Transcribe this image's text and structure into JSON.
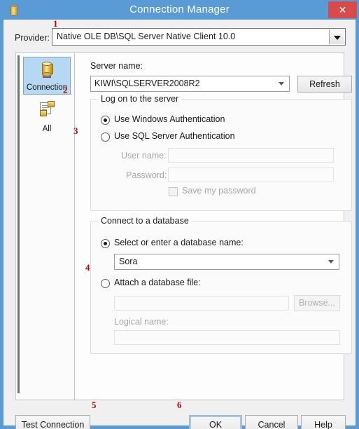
{
  "window": {
    "title": "Connection Manager",
    "icon": "database-icon",
    "close_label": "✕",
    "titlebar_color": "#5b9bd5",
    "close_color": "#d94a4a",
    "marker_color": "#c00000"
  },
  "provider": {
    "label": "Provider:",
    "value": "Native OLE DB\\SQL Server Native Client 10.0",
    "marker": "1"
  },
  "sidebar": {
    "items": [
      {
        "label": "Connection",
        "icon": "database-icon",
        "selected": true
      },
      {
        "label": "All",
        "icon": "properties-icon",
        "selected": false
      }
    ]
  },
  "server": {
    "label": "Server name:",
    "value": "KIWI\\SQLSERVER2008R2",
    "refresh_label": "Refresh",
    "marker": "2"
  },
  "logon": {
    "group_title": "Log on to the server",
    "windows_auth_label": "Use Windows Authentication",
    "windows_auth_selected": true,
    "sql_auth_label": "Use SQL Server Authentication",
    "sql_auth_selected": false,
    "username_label": "User name:",
    "username_value": "",
    "password_label": "Password:",
    "password_value": "",
    "save_password_label": "Save my password",
    "save_password_checked": false,
    "marker": "3"
  },
  "database": {
    "group_title": "Connect to a database",
    "select_db_label": "Select or enter a database name:",
    "select_db_selected": true,
    "db_value": "Sora",
    "attach_label": "Attach a database file:",
    "attach_selected": false,
    "attach_value": "",
    "browse_label": "Browse...",
    "logical_name_label": "Logical name:",
    "logical_name_value": "",
    "marker": "4"
  },
  "footer": {
    "test_label": "Test Connection",
    "ok_label": "OK",
    "cancel_label": "Cancel",
    "help_label": "Help",
    "marker_test": "5",
    "marker_ok": "6"
  }
}
